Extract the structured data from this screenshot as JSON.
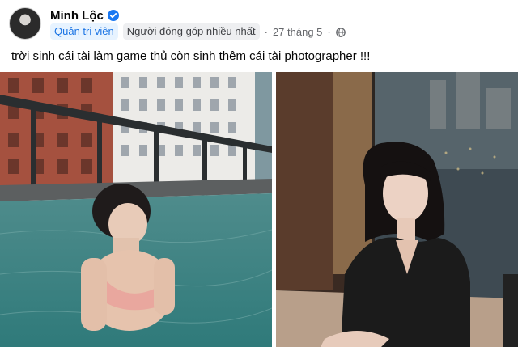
{
  "post": {
    "author_name": "Minh Lộc",
    "badges": {
      "admin": "Quản trị viên",
      "contributor": "Người đóng góp nhiều nhất"
    },
    "timestamp": "27 tháng 5",
    "separator": "·",
    "privacy_icon": "globe-icon",
    "verified_icon": "verified-badge-icon",
    "text": "trời sinh cái tài làm game thủ còn sinh thêm cái tài photographer !!!"
  },
  "colors": {
    "admin_badge_text": "#1b74e4",
    "admin_badge_bg": "#e7f3ff",
    "meta_text": "#65676b",
    "verified": "#1877f2"
  },
  "photos": [
    {
      "name": "rooftop-pool-photo"
    },
    {
      "name": "hotel-window-photo"
    }
  ]
}
